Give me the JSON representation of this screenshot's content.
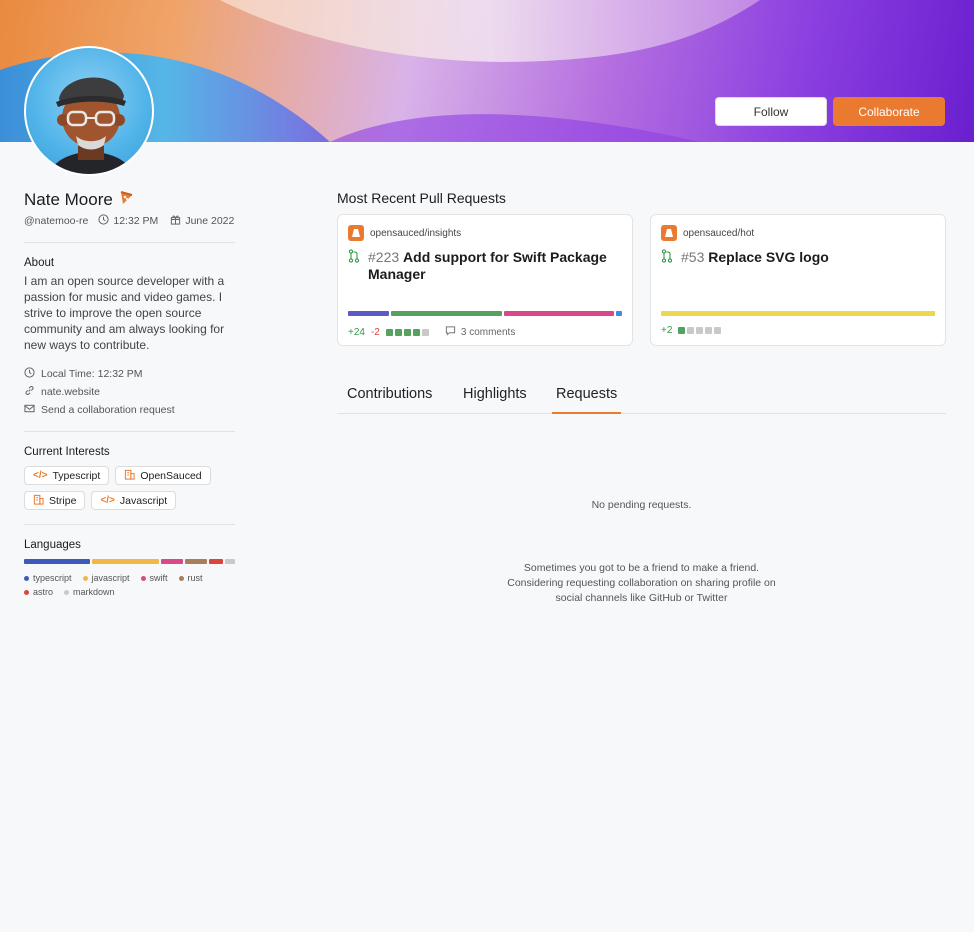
{
  "header": {
    "follow_label": "Follow",
    "collaborate_label": "Collaborate"
  },
  "profile": {
    "name": "Nate Moore",
    "username": "@natemoo-re",
    "time": "12:32 PM",
    "joined": "June 2022"
  },
  "about": {
    "title": "About",
    "text": "I am an open source developer with a passion for music and video games. I strive to improve the open source community and am always looking for new ways to contribute.",
    "local_time": "Local Time: 12:32 PM",
    "website": "nate.website",
    "collab_request": "Send a collaboration request"
  },
  "interests": {
    "title": "Current Interests",
    "items": [
      {
        "label": "Typescript",
        "icon": "code-icon"
      },
      {
        "label": "OpenSauced",
        "icon": "building-icon"
      },
      {
        "label": "Stripe",
        "icon": "building-icon"
      },
      {
        "label": "Javascript",
        "icon": "code-icon"
      }
    ]
  },
  "languages": {
    "title": "Languages",
    "items": [
      {
        "name": "typescript",
        "color": "#3d5ab8",
        "share": 33
      },
      {
        "name": "javascript",
        "color": "#f3b64b",
        "share": 33
      },
      {
        "name": "swift",
        "color": "#d9498a",
        "share": 11
      },
      {
        "name": "rust",
        "color": "#a97c5b",
        "share": 11
      },
      {
        "name": "astro",
        "color": "#d9473b",
        "share": 7
      },
      {
        "name": "markdown",
        "color": "#c9c9c9",
        "share": 5
      }
    ]
  },
  "pull_requests": {
    "title": "Most Recent Pull Requests",
    "cards": [
      {
        "repo": "opensauced/insights",
        "number": "#223",
        "title": "Add support for Swift Package Manager",
        "additions": "+24",
        "deletions": "-2",
        "comments": "3 comments",
        "bar": [
          {
            "color": "#5b5bc8",
            "share": 15
          },
          {
            "color": "#55a160",
            "share": 40
          },
          {
            "color": "#d9498a",
            "share": 40
          },
          {
            "color": "#3b8ee0",
            "share": 2
          }
        ],
        "squares": [
          "#55a160",
          "#55a160",
          "#55a160",
          "#55a160",
          "#c9c9c9"
        ]
      },
      {
        "repo": "opensauced/hot",
        "number": "#53",
        "title": "Replace SVG logo",
        "additions": "+2",
        "deletions": "",
        "comments": "",
        "bar": [
          {
            "color": "#ecd84a",
            "share": 100
          }
        ],
        "squares": [
          "#55a160",
          "#c9c9c9",
          "#c9c9c9",
          "#c9c9c9",
          "#c9c9c9"
        ]
      }
    ]
  },
  "tabs": {
    "items": [
      "Contributions",
      "Highlights",
      "Requests"
    ],
    "active": "Requests"
  },
  "requests": {
    "empty_text": "No pending requests.",
    "hint": "Sometimes you got to be a friend to make a friend. Considering requesting collaboration on sharing profile on social channels like GitHub or Twitter"
  }
}
